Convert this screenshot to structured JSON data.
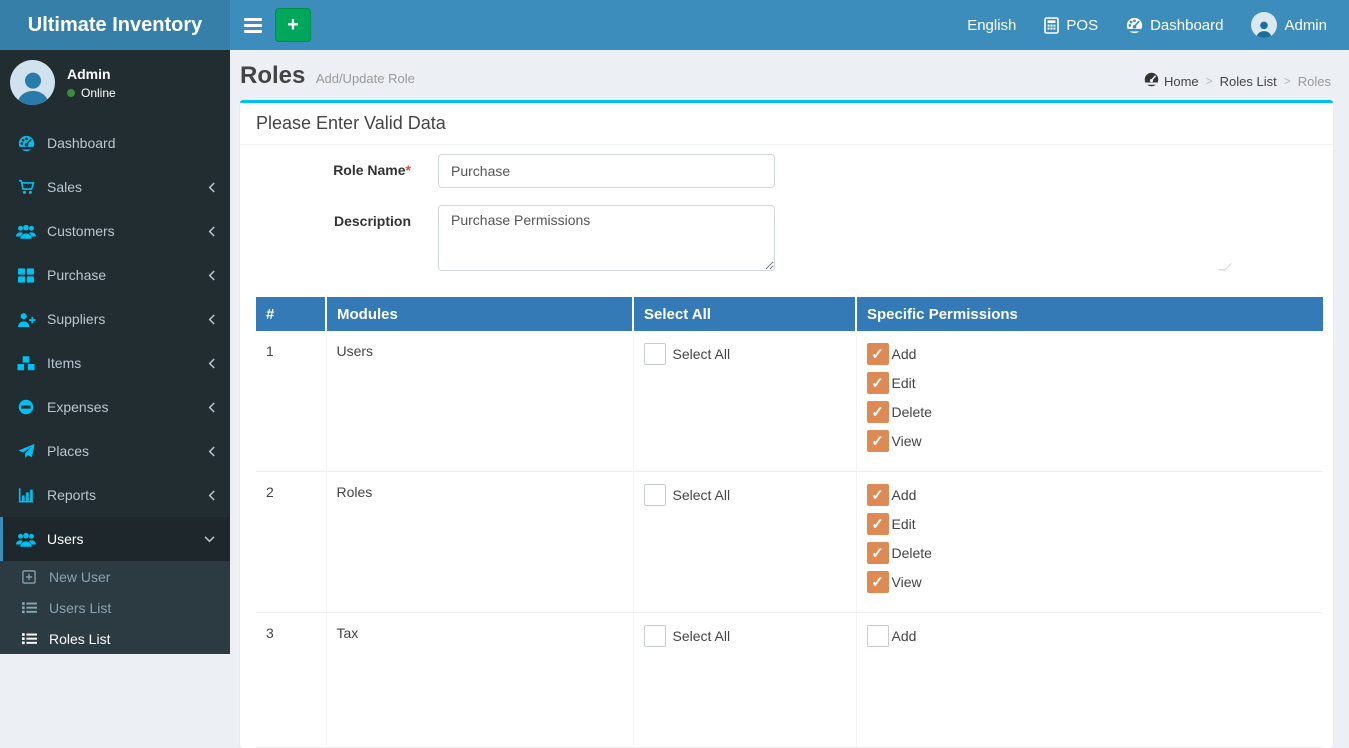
{
  "app": {
    "title": "Ultimate Inventory"
  },
  "topbar": {
    "language": "English",
    "pos_label": "POS",
    "dashboard_label": "Dashboard",
    "user_label": "Admin"
  },
  "sidebar": {
    "user": {
      "name": "Admin",
      "status": "Online"
    },
    "items": [
      {
        "label": "Dashboard"
      },
      {
        "label": "Sales"
      },
      {
        "label": "Customers"
      },
      {
        "label": "Purchase"
      },
      {
        "label": "Suppliers"
      },
      {
        "label": "Items"
      },
      {
        "label": "Expenses"
      },
      {
        "label": "Places"
      },
      {
        "label": "Reports"
      },
      {
        "label": "Users",
        "active": true
      }
    ],
    "subitems": [
      {
        "label": "New User"
      },
      {
        "label": "Users List"
      },
      {
        "label": "Roles List",
        "active": true
      }
    ]
  },
  "page": {
    "title": "Roles",
    "subtitle": "Add/Update Role",
    "breadcrumb": [
      "Home",
      "Roles List",
      "Roles"
    ],
    "breadcrumb_separator": ">"
  },
  "panel": {
    "header": "Please Enter Valid Data",
    "form": {
      "role_name_label": "Role Name",
      "required_mark": "*",
      "role_name_value": "Purchase",
      "description_label": "Description",
      "description_value": "Purchase Permissions"
    },
    "table": {
      "headers": [
        "#",
        "Modules",
        "Select All",
        "Specific Permissions"
      ],
      "select_all_label": "Select All",
      "rows": [
        {
          "num": "1",
          "module": "Users",
          "select_all_checked": false,
          "permissions": [
            {
              "label": "Add",
              "checked": true
            },
            {
              "label": "Edit",
              "checked": true
            },
            {
              "label": "Delete",
              "checked": true
            },
            {
              "label": "View",
              "checked": true
            }
          ]
        },
        {
          "num": "2",
          "module": "Roles",
          "select_all_checked": false,
          "permissions": [
            {
              "label": "Add",
              "checked": true
            },
            {
              "label": "Edit",
              "checked": true
            },
            {
              "label": "Delete",
              "checked": true
            },
            {
              "label": "View",
              "checked": true
            }
          ]
        },
        {
          "num": "3",
          "module": "Tax",
          "select_all_checked": false,
          "permissions": [
            {
              "label": "Add",
              "checked": false
            }
          ]
        }
      ]
    }
  },
  "icons": {
    "hamburger-icon": "three horizontal bars",
    "add-icon": "plus sign",
    "calculator-icon": "calculator",
    "dashboard-icon": "speedometer gauge",
    "avatar": "person silhouette",
    "cart-icon": "shopping cart",
    "users-icon": "group of people",
    "grid-icon": "four squares",
    "user-plus-icon": "person with plus",
    "cubes-icon": "stacked cubes",
    "minus-circle-icon": "circle with minus",
    "paper-plane-icon": "paper plane",
    "bar-chart-icon": "bar chart",
    "plus-square-icon": "outlined square with plus",
    "list-icon": "bulleted list",
    "chevron-left-icon": "angle left",
    "chevron-down-icon": "angle down",
    "checkmark-icon": "check mark"
  },
  "colors": {
    "navbar": "#3c8dbc",
    "logo_bg": "#367fa9",
    "sidebar_bg": "#222d32",
    "submenu_bg": "#2c3b41",
    "active_item_bg": "#1e282c",
    "icon_cyan": "#00c0ef",
    "content_bg": "#ecf0f5",
    "box_top_border": "#00c0ef",
    "table_header_bg": "#337ab7",
    "checked_checkbox": "#dd8a55",
    "add_button": "#00a65a",
    "online_dot": "#3d8b40",
    "required_red": "#dd4b39"
  }
}
